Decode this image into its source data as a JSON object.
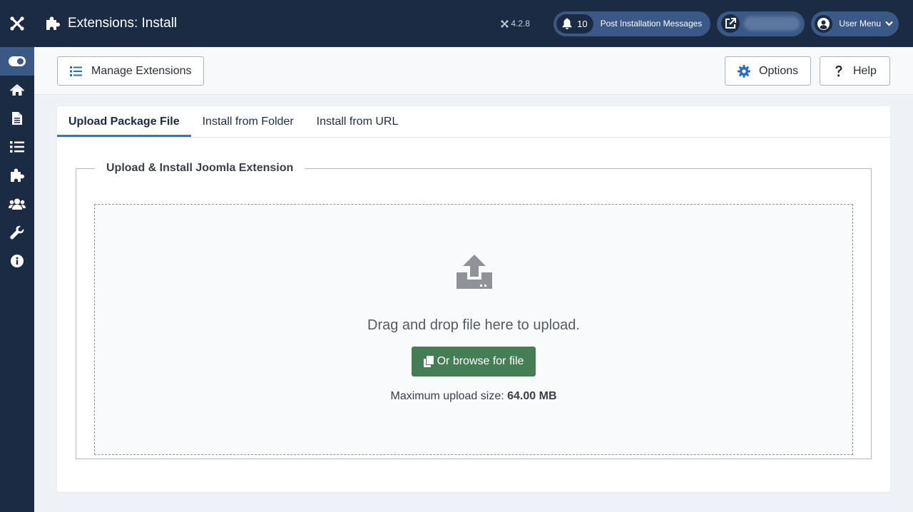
{
  "app": {
    "page_title": "Extensions: Install",
    "version": "4.2.8"
  },
  "header": {
    "messages_count": "10",
    "messages_label": "Post Installation Messages",
    "user_menu_label": "User Menu"
  },
  "sidebar": {
    "items": [
      {
        "name": "toggle-menu",
        "icon": "toggle-icon"
      },
      {
        "name": "home-dashboard",
        "icon": "home-icon"
      },
      {
        "name": "content",
        "icon": "file-icon"
      },
      {
        "name": "menus",
        "icon": "list-icon"
      },
      {
        "name": "components",
        "icon": "puzzle-icon"
      },
      {
        "name": "users",
        "icon": "users-icon"
      },
      {
        "name": "system",
        "icon": "wrench-icon"
      },
      {
        "name": "help",
        "icon": "info-icon"
      }
    ]
  },
  "toolbar": {
    "manage_label": "Manage Extensions",
    "options_label": "Options",
    "help_label": "Help"
  },
  "tabs": [
    {
      "label": "Upload Package File",
      "active": true
    },
    {
      "label": "Install from Folder",
      "active": false
    },
    {
      "label": "Install from URL",
      "active": false
    }
  ],
  "upload": {
    "legend": "Upload & Install Joomla Extension",
    "drag_text": "Drag and drop file here to upload.",
    "browse_label": "Or browse for file",
    "max_label": "Maximum upload size:",
    "max_value": "64.00 MB"
  },
  "colors": {
    "sidebar_bg": "#1c2b44",
    "accent": "#3b5987",
    "tab_active_border": "#3b73b9",
    "browse_button": "#457d54",
    "options_icon": "#2f6bbd"
  }
}
